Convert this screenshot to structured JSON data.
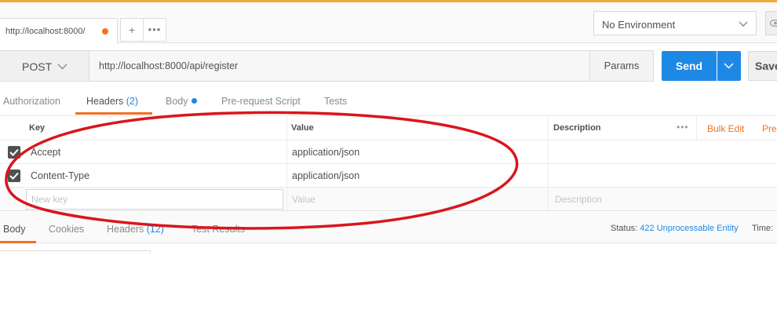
{
  "tabstrip": {
    "active_tab_label": "http://localhost:8000/",
    "add_tab_symbol": "+",
    "more_symbol": "•••"
  },
  "environment": {
    "selected": "No Environment"
  },
  "request": {
    "method": "POST",
    "url": "http://localhost:8000/api/register",
    "params_label": "Params",
    "send_label": "Send",
    "save_label": "Save"
  },
  "request_tabs": {
    "authorization": "Authorization",
    "headers": "Headers",
    "headers_count": "(2)",
    "body": "Body",
    "prerequest": "Pre-request Script",
    "tests": "Tests"
  },
  "headers_table": {
    "columns": {
      "key": "Key",
      "value": "Value",
      "description": "Description"
    },
    "more_symbol": "•••",
    "bulk_edit": "Bulk Edit",
    "presets": "Presets",
    "rows": [
      {
        "key": "Accept",
        "value": "application/json",
        "checked": true
      },
      {
        "key": "Content-Type",
        "value": "application/json",
        "checked": true
      }
    ],
    "new_row": {
      "key_placeholder": "New key",
      "value_placeholder": "Value",
      "description_placeholder": "Description"
    }
  },
  "response_tabs": {
    "body": "Body",
    "cookies": "Cookies",
    "headers": "Headers",
    "headers_count": "(12)",
    "test_results": "Test Results"
  },
  "response_status": {
    "status_label": "Status:",
    "status_value": "422 Unprocessable Entity",
    "time_label": "Time:"
  },
  "colors": {
    "accent_orange": "#f47023",
    "send_blue": "#1e88e5",
    "annotation_red": "#d9161c"
  },
  "icons": {
    "unsaved_dot": "orange-dot-icon",
    "env_chevron": "chevron-down-icon",
    "eye": "eye-icon",
    "method_chevron": "chevron-down-icon",
    "send_chevron": "chevron-down-icon",
    "checkbox": "checkbox-checked-icon"
  }
}
